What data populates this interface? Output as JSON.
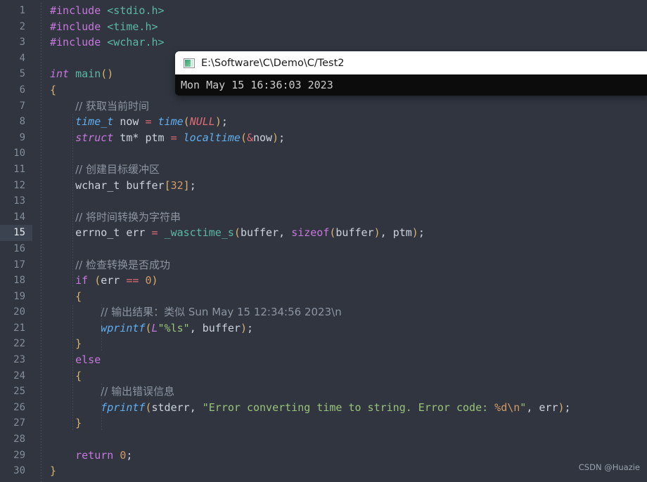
{
  "editor": {
    "background": "#30353f",
    "active_line": 15,
    "line_numbers": [
      "1",
      "2",
      "3",
      "4",
      "5",
      "6",
      "7",
      "8",
      "9",
      "10",
      "11",
      "12",
      "13",
      "14",
      "15",
      "16",
      "17",
      "18",
      "19",
      "20",
      "21",
      "22",
      "23",
      "24",
      "25",
      "26",
      "27",
      "28",
      "29",
      "30"
    ],
    "lines": [
      {
        "n": "1",
        "text": "#include <stdio.h>"
      },
      {
        "n": "2",
        "text": "#include <time.h>"
      },
      {
        "n": "3",
        "text": "#include <wchar.h>"
      },
      {
        "n": "4",
        "text": ""
      },
      {
        "n": "5",
        "text": "int main()"
      },
      {
        "n": "6",
        "text": "{"
      },
      {
        "n": "7",
        "text": "    // 获取当前时间"
      },
      {
        "n": "8",
        "text": "    time_t now = time(NULL);"
      },
      {
        "n": "9",
        "text": "    struct tm* ptm = localtime(&now);"
      },
      {
        "n": "10",
        "text": ""
      },
      {
        "n": "11",
        "text": "    // 创建目标缓冲区"
      },
      {
        "n": "12",
        "text": "    wchar_t buffer[32];"
      },
      {
        "n": "13",
        "text": ""
      },
      {
        "n": "14",
        "text": "    // 将时间转换为字符串"
      },
      {
        "n": "15",
        "text": "    errno_t err = _wasctime_s(buffer, sizeof(buffer), ptm);"
      },
      {
        "n": "16",
        "text": ""
      },
      {
        "n": "17",
        "text": "    // 检查转换是否成功"
      },
      {
        "n": "18",
        "text": "    if (err == 0)"
      },
      {
        "n": "19",
        "text": "    {"
      },
      {
        "n": "20",
        "text": "        // 输出结果：类似 Sun May 15 12:34:56 2023\\n"
      },
      {
        "n": "21",
        "text": "        wprintf(L\"%ls\", buffer);"
      },
      {
        "n": "22",
        "text": "    }"
      },
      {
        "n": "23",
        "text": "    else"
      },
      {
        "n": "24",
        "text": "    {"
      },
      {
        "n": "25",
        "text": "        // 输出错误信息"
      },
      {
        "n": "26",
        "text": "        fprintf(stderr, \"Error converting time to string. Error code: %d\\n\", err);"
      },
      {
        "n": "27",
        "text": "    }"
      },
      {
        "n": "28",
        "text": ""
      },
      {
        "n": "29",
        "text": "    return 0;"
      },
      {
        "n": "30",
        "text": "}"
      }
    ],
    "tokens": {
      "include": "#include",
      "hdr_stdio": "<stdio.h>",
      "hdr_time": "<time.h>",
      "hdr_wchar": "<wchar.h>",
      "kw_int": "int",
      "fn_main": "main",
      "paren_open": "(",
      "paren_close": ")",
      "brace_open": "{",
      "brace_close": "}",
      "cm_get_time": "// 获取当前时间",
      "type_time_t": "time_t",
      "id_now": "now",
      "op_assign": "=",
      "fn_time": "time",
      "const_null": "NULL",
      "semi": ";",
      "kw_struct": "struct",
      "id_tm_ptr": "tm*",
      "id_ptm": "ptm",
      "fn_localtime": "localtime",
      "op_amp": "&",
      "cm_create_buffer": "// 创建目标缓冲区",
      "type_wchar_t": "wchar_t",
      "id_buffer": "buffer",
      "brack_open": "[",
      "num_32": "32",
      "brack_close": "]",
      "cm_convert": "// 将时间转换为字符串",
      "type_errno_t": "errno_t",
      "id_err": "err",
      "fn_wasctime": "_wasctime_s",
      "kw_sizeof": "sizeof",
      "comma": ",",
      "cm_check": "// 检查转换是否成功",
      "kw_if": "if",
      "op_eq": "==",
      "num_0": "0",
      "cm_output_result": "// 输出结果：类似 Sun May 15 12:34:56 2023\\n",
      "fn_wprintf": "wprintf",
      "kw_L": "L",
      "str_ls": "\"%ls\"",
      "kw_else": "else",
      "cm_output_error": "// 输出错误信息",
      "fn_fprintf": "fprintf",
      "id_stderr": "stderr",
      "str_error_a": "\"Error converting time to string. Error code: ",
      "str_error_esc": "%d\\n",
      "str_error_b": "\"",
      "kw_return": "return"
    }
  },
  "console_window": {
    "title": "E:\\Software\\C\\Demo\\C/Test2",
    "icon": "console-app-icon",
    "output": "Mon May 15 16:36:03 2023",
    "title_bar_color": "#ffffff",
    "body_color": "#0c0c0c"
  },
  "watermark": {
    "text": "CSDN @Huazie"
  }
}
